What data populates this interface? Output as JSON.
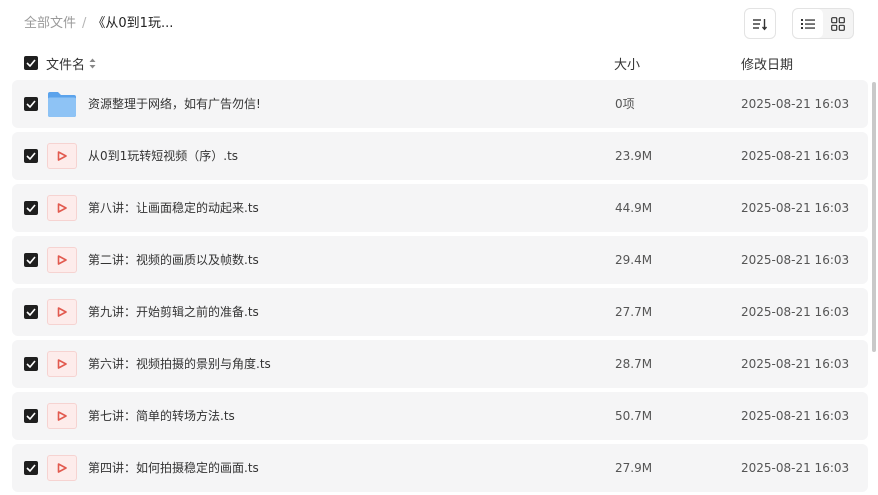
{
  "breadcrumb": {
    "root": "全部文件",
    "separator": "/",
    "current": "《从0到1玩..."
  },
  "toolbar": {
    "sort_icon": "sort-icon",
    "list_view_icon": "list-view-icon",
    "grid_view_icon": "grid-view-icon",
    "active_view": "list"
  },
  "columns": {
    "name": "文件名",
    "size": "大小",
    "modified": "修改日期"
  },
  "files": [
    {
      "name": "资源整理于网络，如有广告勿信!",
      "size": "0项",
      "modified": "2025-08-21 16:03",
      "type": "folder",
      "checked": true
    },
    {
      "name": "从0到1玩转短视频（序）.ts",
      "size": "23.9M",
      "modified": "2025-08-21 16:03",
      "type": "video",
      "checked": true
    },
    {
      "name": "第八讲：让画面稳定的动起来.ts",
      "size": "44.9M",
      "modified": "2025-08-21 16:03",
      "type": "video",
      "checked": true
    },
    {
      "name": "第二讲：视频的画质以及帧数.ts",
      "size": "29.4M",
      "modified": "2025-08-21 16:03",
      "type": "video",
      "checked": true
    },
    {
      "name": "第九讲：开始剪辑之前的准备.ts",
      "size": "27.7M",
      "modified": "2025-08-21 16:03",
      "type": "video",
      "checked": true
    },
    {
      "name": "第六讲：视频拍摄的景别与角度.ts",
      "size": "28.7M",
      "modified": "2025-08-21 16:03",
      "type": "video",
      "checked": true
    },
    {
      "name": "第七讲：简单的转场方法.ts",
      "size": "50.7M",
      "modified": "2025-08-21 16:03",
      "type": "video",
      "checked": true
    },
    {
      "name": "第四讲：如何拍摄稳定的画面.ts",
      "size": "27.9M",
      "modified": "2025-08-21 16:03",
      "type": "video",
      "checked": true
    }
  ],
  "colors": {
    "row_bg": "#f5f5f6",
    "checkbox": "#1f1f1f",
    "folder": "#7bb6f2",
    "video_icon": "#e25a4f"
  }
}
